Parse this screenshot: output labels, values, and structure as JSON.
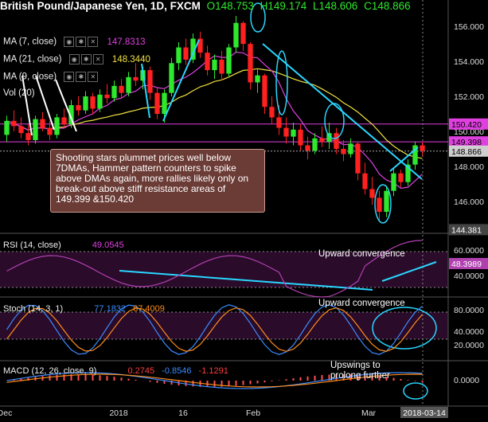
{
  "header": {
    "symbol": "British Pound/Japanese Yen, 1D, FXCM",
    "open": "O148.753",
    "high": "H149.174",
    "low": "L148.606",
    "close": "C148.866"
  },
  "indicators": {
    "ma7": {
      "label": "MA (7, close)",
      "value": "147.8313",
      "color": "#e040e0"
    },
    "ma21": {
      "label": "MA (21, close)",
      "value": "148.3440",
      "color": "#f0e040"
    },
    "ma9": {
      "label": "MA (9, close)"
    },
    "vol": {
      "label": "Vol (20)"
    }
  },
  "note": "Shooting stars plummet prices well below 7DMAs, Hammer pattern counters to spike above DMAs again, more rallies likely only on break-out above stiff resistance areas of 149.399 &150.420",
  "rsi": {
    "label": "RSI (14, close)",
    "value": "49.0545",
    "annotation": "Upward convergence"
  },
  "stoch": {
    "label": "Stoch (14, 3, 1)",
    "k": "77.1832",
    "d": "67.4009",
    "annotation": "Upward convergence"
  },
  "macd": {
    "label": "MACD (12, 26, close, 9)",
    "hist": "0.2745",
    "macd": "-0.8546",
    "signal": "-1.1291",
    "annotation": "Upswings to prolong further"
  },
  "price_axis": {
    "ticks": [
      "156.000",
      "154.000",
      "152.000",
      "150.000",
      "148.000",
      "146.000"
    ],
    "tags": [
      {
        "text": "150.420",
        "color": "#e040e0"
      },
      {
        "text": "149.398",
        "color": "#e040e0"
      },
      {
        "text": "148.866",
        "color": "#cfcfcf"
      },
      {
        "text": "144.381",
        "color": "#444444"
      }
    ]
  },
  "rsi_axis": {
    "ticks": [
      "60.0000",
      "40.0000"
    ],
    "tag": "48.3989"
  },
  "stoch_axis": {
    "ticks": [
      "80.0000",
      "40.0000",
      "20.0000"
    ]
  },
  "macd_axis": {
    "ticks": [
      "0.0000"
    ]
  },
  "time_axis": {
    "labels": [
      "Dec",
      "2018",
      "16",
      "Feb",
      "Mar"
    ],
    "cursor": "2018-03-14"
  },
  "colors": {
    "bull": "#2ee82e",
    "bear": "#ff2020",
    "ma7": "#e040e0",
    "ma21": "#f0e040",
    "trend": "#29d6ff",
    "grid": "#1a1a1a",
    "panel": "#2a0b2a"
  },
  "chart_data": {
    "type": "candlestick",
    "title": "British Pound/Japanese Yen, 1D, FXCM",
    "ylim": [
      144.4,
      156.6
    ],
    "candles": [
      [
        149.8,
        150.9,
        149.4,
        150.6
      ],
      [
        150.6,
        151.2,
        150.0,
        150.3
      ],
      [
        150.3,
        150.8,
        149.6,
        149.9
      ],
      [
        149.9,
        150.4,
        149.2,
        149.5
      ],
      [
        149.5,
        150.9,
        149.3,
        150.7
      ],
      [
        150.7,
        151.1,
        150.0,
        150.2
      ],
      [
        150.2,
        150.6,
        149.5,
        149.8
      ],
      [
        149.8,
        151.0,
        149.6,
        150.8
      ],
      [
        150.8,
        151.3,
        150.2,
        150.4
      ],
      [
        150.4,
        151.8,
        150.2,
        151.5
      ],
      [
        151.5,
        152.0,
        150.9,
        151.2
      ],
      [
        151.2,
        152.3,
        151.0,
        152.0
      ],
      [
        152.0,
        152.2,
        151.0,
        151.3
      ],
      [
        151.3,
        152.4,
        151.1,
        152.1
      ],
      [
        152.1,
        152.7,
        151.6,
        151.9
      ],
      [
        151.9,
        152.9,
        151.7,
        152.6
      ],
      [
        152.6,
        153.0,
        151.9,
        152.2
      ],
      [
        152.2,
        153.4,
        152.0,
        153.1
      ],
      [
        153.1,
        153.9,
        152.6,
        152.9
      ],
      [
        152.9,
        153.7,
        152.4,
        153.5
      ],
      [
        153.5,
        153.7,
        151.8,
        152.2
      ],
      [
        152.2,
        152.5,
        150.7,
        151.0
      ],
      [
        151.0,
        152.4,
        150.5,
        152.2
      ],
      [
        152.2,
        154.2,
        152.0,
        153.9
      ],
      [
        153.9,
        155.1,
        153.5,
        154.8
      ],
      [
        154.8,
        155.3,
        153.8,
        154.1
      ],
      [
        154.1,
        155.6,
        153.9,
        155.3
      ],
      [
        155.3,
        155.7,
        154.2,
        154.5
      ],
      [
        154.5,
        154.9,
        153.2,
        153.5
      ],
      [
        153.5,
        154.4,
        153.0,
        154.1
      ],
      [
        154.1,
        154.6,
        152.9,
        153.3
      ],
      [
        153.3,
        155.0,
        153.1,
        154.8
      ],
      [
        154.8,
        156.6,
        154.5,
        156.2
      ],
      [
        156.2,
        156.3,
        154.6,
        155.0
      ],
      [
        155.0,
        155.1,
        152.4,
        152.8
      ],
      [
        152.8,
        153.6,
        152.2,
        153.2
      ],
      [
        153.2,
        153.3,
        151.0,
        151.4
      ],
      [
        151.4,
        152.0,
        150.4,
        150.8
      ],
      [
        150.8,
        151.5,
        149.8,
        150.2
      ],
      [
        150.2,
        150.8,
        149.3,
        149.7
      ],
      [
        149.7,
        150.5,
        149.2,
        150.1
      ],
      [
        150.1,
        150.4,
        148.9,
        149.2
      ],
      [
        149.2,
        149.7,
        148.4,
        148.9
      ],
      [
        148.9,
        149.9,
        148.7,
        149.6
      ],
      [
        149.6,
        150.3,
        149.1,
        149.4
      ],
      [
        149.4,
        150.5,
        149.0,
        149.9
      ],
      [
        149.9,
        150.2,
        148.7,
        149.0
      ],
      [
        149.0,
        149.5,
        148.3,
        148.7
      ],
      [
        148.7,
        149.6,
        148.5,
        149.3
      ],
      [
        149.3,
        149.4,
        147.2,
        147.6
      ],
      [
        147.6,
        148.2,
        146.4,
        146.7
      ],
      [
        146.7,
        147.4,
        145.8,
        146.2
      ],
      [
        146.2,
        146.6,
        144.9,
        145.4
      ],
      [
        145.4,
        146.9,
        145.1,
        146.6
      ],
      [
        146.6,
        147.9,
        146.3,
        147.6
      ],
      [
        147.6,
        147.8,
        146.8,
        147.1
      ],
      [
        147.1,
        148.4,
        146.9,
        148.1
      ],
      [
        148.1,
        149.4,
        147.8,
        149.2
      ],
      [
        149.2,
        149.4,
        148.6,
        148.9
      ]
    ]
  }
}
